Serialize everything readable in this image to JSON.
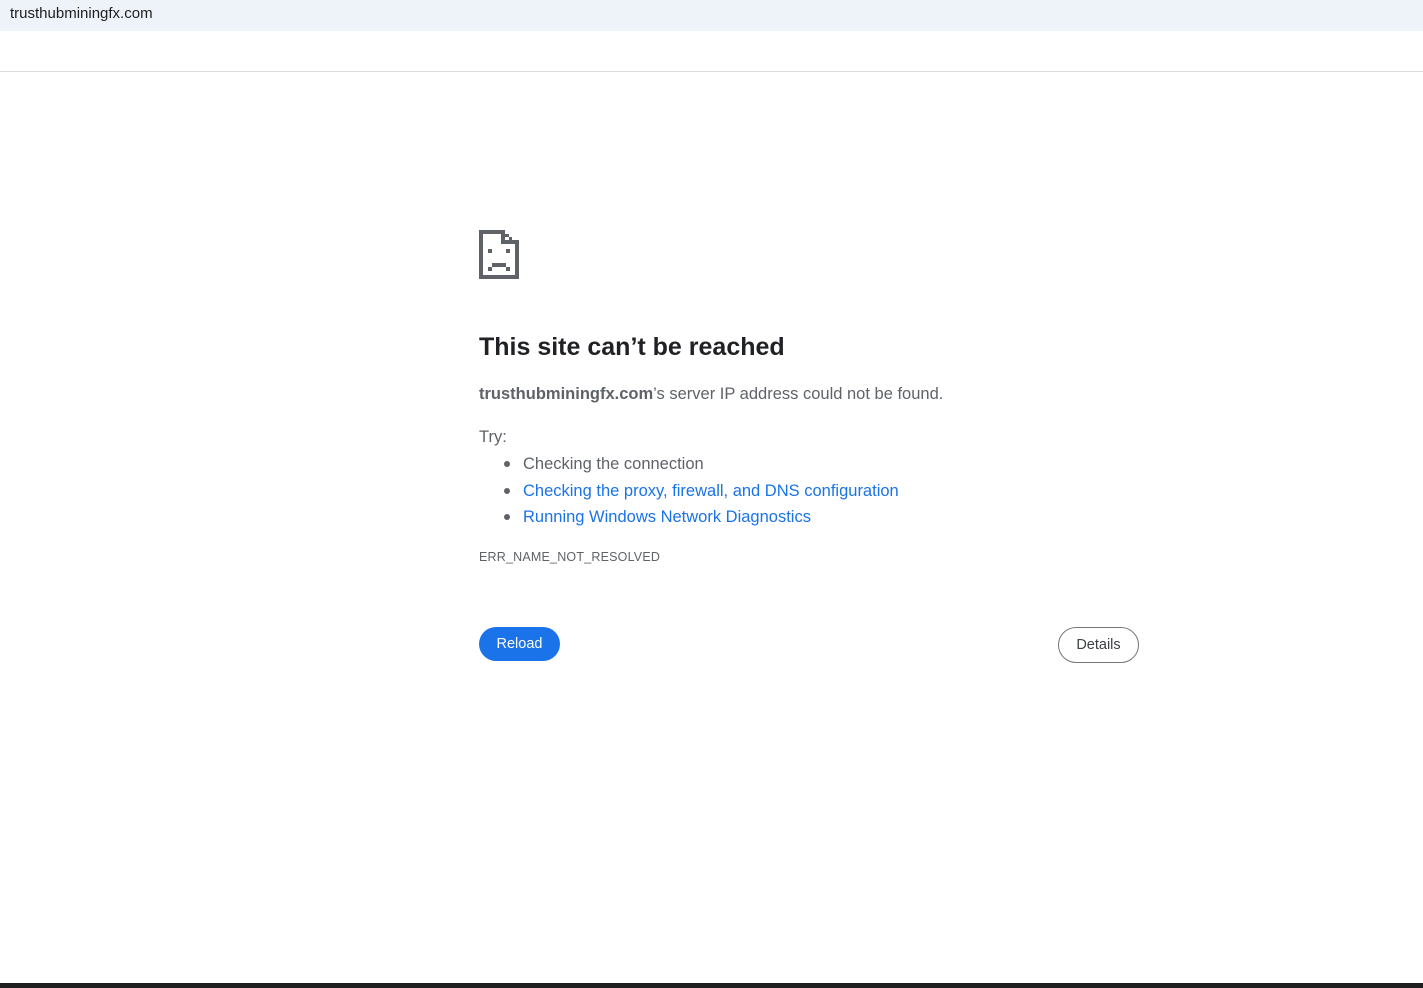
{
  "address_bar": {
    "url": "trusthubminingfx.com"
  },
  "error": {
    "icon": "sad-page-icon",
    "heading": "This site can’t be reached",
    "host": "trusthubminingfx.com",
    "summary_suffix": "’s server IP address could not be found.",
    "try_label": "Try:",
    "suggestions": [
      {
        "text": "Checking the connection",
        "link": false
      },
      {
        "text": "Checking the proxy, firewall, and DNS configuration",
        "link": true
      },
      {
        "text": "Running Windows Network Diagnostics",
        "link": true
      }
    ],
    "code": "ERR_NAME_NOT_RESOLVED"
  },
  "buttons": {
    "reload_label": "Reload",
    "details_label": "Details"
  },
  "colors": {
    "accent": "#1a73e8",
    "text_secondary": "#5f6368",
    "heading": "#202124",
    "address_bar_bg": "#eef2f9"
  }
}
